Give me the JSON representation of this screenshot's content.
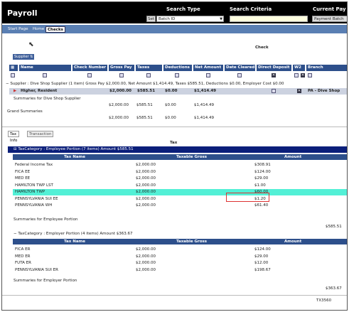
{
  "app": {
    "title": "Payroll",
    "search_type_label": "Search Type",
    "search_criteria_label": "Search Criteria",
    "current_pay_label": "Current Pay",
    "set_button": "Set",
    "search_type_value": "Batch ID",
    "payment_batch_button": "Payment Batch"
  },
  "nav": {
    "tabs": [
      "Start Page",
      "Home",
      "Checks"
    ]
  },
  "check_section": {
    "heading": "Check",
    "supplier_button": "Supplier"
  },
  "columns": [
    "Name",
    "Check Number",
    "Gross Pay",
    "Taxes",
    "Deductions",
    "Net Amount",
    "Date Cleared",
    "Direct Deposit",
    "W2",
    "Branch"
  ],
  "group_line": "Supplier : Dive Shop Supplier (1 item) Gross Pay $2,000.00, Net Amount $1,414.49, Taxes $585.51, Deductions $0.00, Employer Cost $0.00",
  "row": {
    "name": "Higher, Resident",
    "gross": "$2,000.00",
    "taxes": "$585.51",
    "deductions": "$0.00",
    "net": "$1,414.49",
    "branch": "PA - Dive Shop"
  },
  "summaries": {
    "supplier_label": "Summaries for Dive Shop Supplier",
    "supplier_gross": "$2,000.00",
    "supplier_taxes": "$585.51",
    "supplier_ded": "$0.00",
    "supplier_net": "$1,414.49",
    "grand_label": "Grand Summaries",
    "grand_gross": "$2,000.00",
    "grand_taxes": "$585.51",
    "grand_ded": "$0.00",
    "grand_net": "$1,414.49"
  },
  "lower_tabs": [
    "Tax Info",
    "Transaction"
  ],
  "tax": {
    "heading": "Tax",
    "cat1": "TaxCategory : Employee Portion (7 items) Amount $585.51",
    "cat2": "TaxCategory : Employer Portion (4 items) Amount $363.67",
    "col_name": "Tax Name",
    "col_gross": "Taxable Gross",
    "col_amount": "Amount",
    "employee_rows": [
      [
        "Federal Income Tax",
        "$2,000.00",
        "$308.91"
      ],
      [
        "FICA EE",
        "$2,000.00",
        "$124.00"
      ],
      [
        "MED EE",
        "$2,000.00",
        "$29.00"
      ],
      [
        "HAMILTON TWP LST",
        "$2,000.00",
        "$1.00"
      ],
      [
        "HAMILTON TWP",
        "$2,000.00",
        "$60.00"
      ],
      [
        "PENNSYLVANIA SUI EE",
        "$2,000.00",
        "$1.20"
      ],
      [
        "PENNSYLVANIA WH",
        "$2,000.00",
        "$61.40"
      ]
    ],
    "employee_summary_label": "Summaries for Employee Portion",
    "employee_total": "$585.51",
    "employer_rows": [
      [
        "FICA ER",
        "$2,000.00",
        "$124.00"
      ],
      [
        "MED ER",
        "$2,000.00",
        "$29.00"
      ],
      [
        "FUTA ER",
        "$2,000.00",
        "$12.00"
      ],
      [
        "PENNSYLVANIA SUI ER",
        "$2,000.00",
        "$198.67"
      ]
    ],
    "employer_summary_label": "Summaries for Employer Portion",
    "employer_total": "$363.67"
  },
  "footer_code": "TX3560"
}
